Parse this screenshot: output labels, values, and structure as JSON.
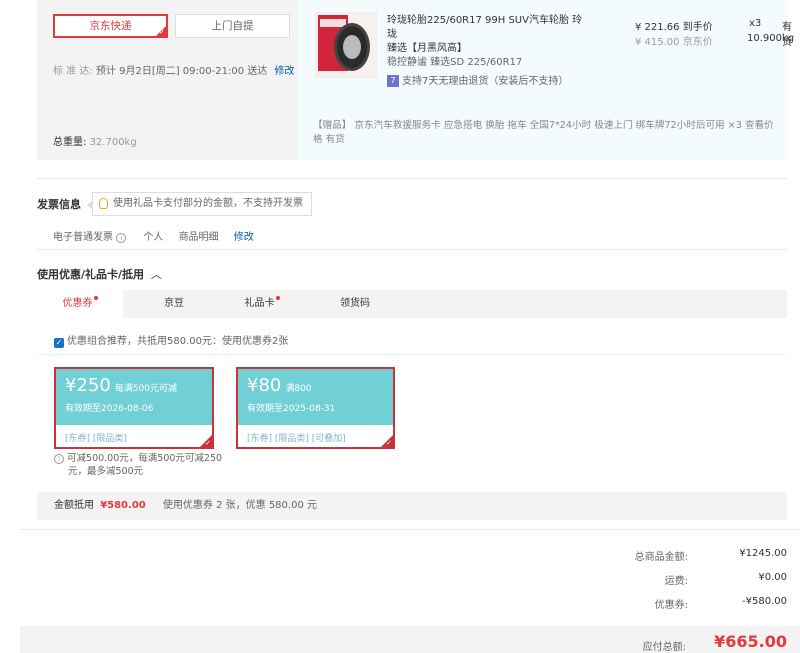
{
  "shipping": {
    "options": [
      "京东快递",
      "上门自提"
    ],
    "standard_label": "标 准 达:",
    "standard_value": "预计 9月2日[周二] 09:00-21:00 送达",
    "modify": "修改",
    "weight_label": "总重量:",
    "weight_value": "32.700kg"
  },
  "product": {
    "title_line1": "玲珑轮胎225/60R17 99H SUV汽车轮胎 玲珑",
    "title_line2": "臻选【月黑风高】",
    "spec": "稳控静谧 臻选SD 225/60R17",
    "return_icon": "7",
    "return_policy": "支持7天无理由退货（安装后不支持）",
    "price": "¥ 221.66 到手价",
    "orig_price": "¥ 415.00 京东价",
    "qty": "x3",
    "stock": "有货",
    "weight": "10.900kg",
    "gift_line1": "【赠品】 京东汽车救援服务卡 应急搭电 换胎 拖车 全国7*24小时 极速上门 绑车牌72小时后可用 ×3  查看价",
    "gift_line2": "格   有货"
  },
  "invoice": {
    "title": "发票信息",
    "tip": "使用礼品卡支付部分的金额，不支持开发票",
    "type": "电子普通发票",
    "who": "个人",
    "content": "商品明细",
    "modify": "修改"
  },
  "discount": {
    "title": "使用优惠/礼品卡/抵用",
    "tabs": [
      "优惠券",
      "京豆",
      "礼品卡",
      "领货码"
    ],
    "combo_text": "优惠组合推荐，共抵用580.00元：使用优惠券2张",
    "coupons": [
      {
        "amount": "¥250",
        "condition": "每满500元可减",
        "valid": "有效期至2026-08-06",
        "tags": "[东券]  [限品类]"
      },
      {
        "amount": "¥80",
        "condition": "满800",
        "valid": "有效期至2025-08-31",
        "tags": "[东券]  [限品类]  [可叠加]"
      }
    ],
    "note_line1": "可减500.00元，每满500元可减250",
    "note_line2": "元，最多减500元",
    "sum_label": "金额抵用",
    "sum_value": "¥580.00",
    "sum_detail": "使用优惠券 2 张，优惠 580.00 元"
  },
  "totals": {
    "goods_label": "总商品金额:",
    "goods_value": "¥1245.00",
    "freight_label": "运费:",
    "freight_value": "¥0.00",
    "coupon_label": "优惠券:",
    "coupon_value": "-¥580.00",
    "pay_label": "应付总额:",
    "pay_value": "¥665.00"
  },
  "colors": {
    "accent": "#e4393c",
    "link": "#005ea7",
    "coupon_bg": "#70d0d6"
  }
}
